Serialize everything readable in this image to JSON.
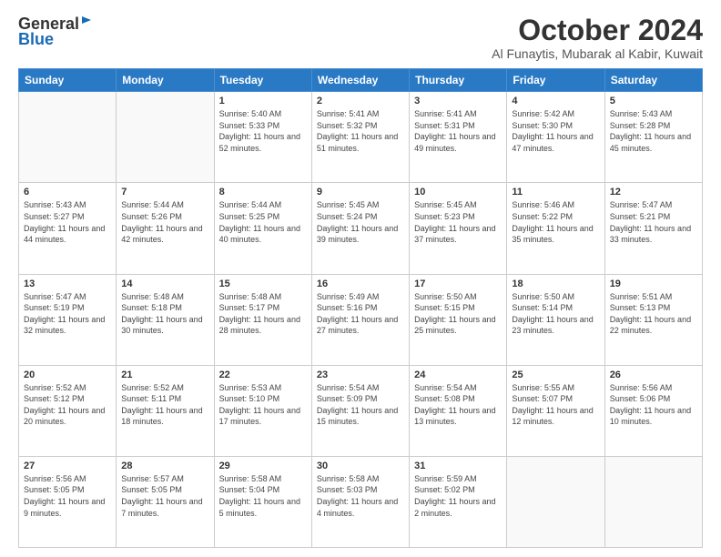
{
  "logo": {
    "general": "General",
    "blue": "Blue"
  },
  "header": {
    "month": "October 2024",
    "location": "Al Funaytis, Mubarak al Kabir, Kuwait"
  },
  "days": [
    "Sunday",
    "Monday",
    "Tuesday",
    "Wednesday",
    "Thursday",
    "Friday",
    "Saturday"
  ],
  "weeks": [
    [
      {
        "date": "",
        "sunrise": "",
        "sunset": "",
        "daylight": ""
      },
      {
        "date": "",
        "sunrise": "",
        "sunset": "",
        "daylight": ""
      },
      {
        "date": "1",
        "sunrise": "Sunrise: 5:40 AM",
        "sunset": "Sunset: 5:33 PM",
        "daylight": "Daylight: 11 hours and 52 minutes."
      },
      {
        "date": "2",
        "sunrise": "Sunrise: 5:41 AM",
        "sunset": "Sunset: 5:32 PM",
        "daylight": "Daylight: 11 hours and 51 minutes."
      },
      {
        "date": "3",
        "sunrise": "Sunrise: 5:41 AM",
        "sunset": "Sunset: 5:31 PM",
        "daylight": "Daylight: 11 hours and 49 minutes."
      },
      {
        "date": "4",
        "sunrise": "Sunrise: 5:42 AM",
        "sunset": "Sunset: 5:30 PM",
        "daylight": "Daylight: 11 hours and 47 minutes."
      },
      {
        "date": "5",
        "sunrise": "Sunrise: 5:43 AM",
        "sunset": "Sunset: 5:28 PM",
        "daylight": "Daylight: 11 hours and 45 minutes."
      }
    ],
    [
      {
        "date": "6",
        "sunrise": "Sunrise: 5:43 AM",
        "sunset": "Sunset: 5:27 PM",
        "daylight": "Daylight: 11 hours and 44 minutes."
      },
      {
        "date": "7",
        "sunrise": "Sunrise: 5:44 AM",
        "sunset": "Sunset: 5:26 PM",
        "daylight": "Daylight: 11 hours and 42 minutes."
      },
      {
        "date": "8",
        "sunrise": "Sunrise: 5:44 AM",
        "sunset": "Sunset: 5:25 PM",
        "daylight": "Daylight: 11 hours and 40 minutes."
      },
      {
        "date": "9",
        "sunrise": "Sunrise: 5:45 AM",
        "sunset": "Sunset: 5:24 PM",
        "daylight": "Daylight: 11 hours and 39 minutes."
      },
      {
        "date": "10",
        "sunrise": "Sunrise: 5:45 AM",
        "sunset": "Sunset: 5:23 PM",
        "daylight": "Daylight: 11 hours and 37 minutes."
      },
      {
        "date": "11",
        "sunrise": "Sunrise: 5:46 AM",
        "sunset": "Sunset: 5:22 PM",
        "daylight": "Daylight: 11 hours and 35 minutes."
      },
      {
        "date": "12",
        "sunrise": "Sunrise: 5:47 AM",
        "sunset": "Sunset: 5:21 PM",
        "daylight": "Daylight: 11 hours and 33 minutes."
      }
    ],
    [
      {
        "date": "13",
        "sunrise": "Sunrise: 5:47 AM",
        "sunset": "Sunset: 5:19 PM",
        "daylight": "Daylight: 11 hours and 32 minutes."
      },
      {
        "date": "14",
        "sunrise": "Sunrise: 5:48 AM",
        "sunset": "Sunset: 5:18 PM",
        "daylight": "Daylight: 11 hours and 30 minutes."
      },
      {
        "date": "15",
        "sunrise": "Sunrise: 5:48 AM",
        "sunset": "Sunset: 5:17 PM",
        "daylight": "Daylight: 11 hours and 28 minutes."
      },
      {
        "date": "16",
        "sunrise": "Sunrise: 5:49 AM",
        "sunset": "Sunset: 5:16 PM",
        "daylight": "Daylight: 11 hours and 27 minutes."
      },
      {
        "date": "17",
        "sunrise": "Sunrise: 5:50 AM",
        "sunset": "Sunset: 5:15 PM",
        "daylight": "Daylight: 11 hours and 25 minutes."
      },
      {
        "date": "18",
        "sunrise": "Sunrise: 5:50 AM",
        "sunset": "Sunset: 5:14 PM",
        "daylight": "Daylight: 11 hours and 23 minutes."
      },
      {
        "date": "19",
        "sunrise": "Sunrise: 5:51 AM",
        "sunset": "Sunset: 5:13 PM",
        "daylight": "Daylight: 11 hours and 22 minutes."
      }
    ],
    [
      {
        "date": "20",
        "sunrise": "Sunrise: 5:52 AM",
        "sunset": "Sunset: 5:12 PM",
        "daylight": "Daylight: 11 hours and 20 minutes."
      },
      {
        "date": "21",
        "sunrise": "Sunrise: 5:52 AM",
        "sunset": "Sunset: 5:11 PM",
        "daylight": "Daylight: 11 hours and 18 minutes."
      },
      {
        "date": "22",
        "sunrise": "Sunrise: 5:53 AM",
        "sunset": "Sunset: 5:10 PM",
        "daylight": "Daylight: 11 hours and 17 minutes."
      },
      {
        "date": "23",
        "sunrise": "Sunrise: 5:54 AM",
        "sunset": "Sunset: 5:09 PM",
        "daylight": "Daylight: 11 hours and 15 minutes."
      },
      {
        "date": "24",
        "sunrise": "Sunrise: 5:54 AM",
        "sunset": "Sunset: 5:08 PM",
        "daylight": "Daylight: 11 hours and 13 minutes."
      },
      {
        "date": "25",
        "sunrise": "Sunrise: 5:55 AM",
        "sunset": "Sunset: 5:07 PM",
        "daylight": "Daylight: 11 hours and 12 minutes."
      },
      {
        "date": "26",
        "sunrise": "Sunrise: 5:56 AM",
        "sunset": "Sunset: 5:06 PM",
        "daylight": "Daylight: 11 hours and 10 minutes."
      }
    ],
    [
      {
        "date": "27",
        "sunrise": "Sunrise: 5:56 AM",
        "sunset": "Sunset: 5:05 PM",
        "daylight": "Daylight: 11 hours and 9 minutes."
      },
      {
        "date": "28",
        "sunrise": "Sunrise: 5:57 AM",
        "sunset": "Sunset: 5:05 PM",
        "daylight": "Daylight: 11 hours and 7 minutes."
      },
      {
        "date": "29",
        "sunrise": "Sunrise: 5:58 AM",
        "sunset": "Sunset: 5:04 PM",
        "daylight": "Daylight: 11 hours and 5 minutes."
      },
      {
        "date": "30",
        "sunrise": "Sunrise: 5:58 AM",
        "sunset": "Sunset: 5:03 PM",
        "daylight": "Daylight: 11 hours and 4 minutes."
      },
      {
        "date": "31",
        "sunrise": "Sunrise: 5:59 AM",
        "sunset": "Sunset: 5:02 PM",
        "daylight": "Daylight: 11 hours and 2 minutes."
      },
      {
        "date": "",
        "sunrise": "",
        "sunset": "",
        "daylight": ""
      },
      {
        "date": "",
        "sunrise": "",
        "sunset": "",
        "daylight": ""
      }
    ]
  ]
}
